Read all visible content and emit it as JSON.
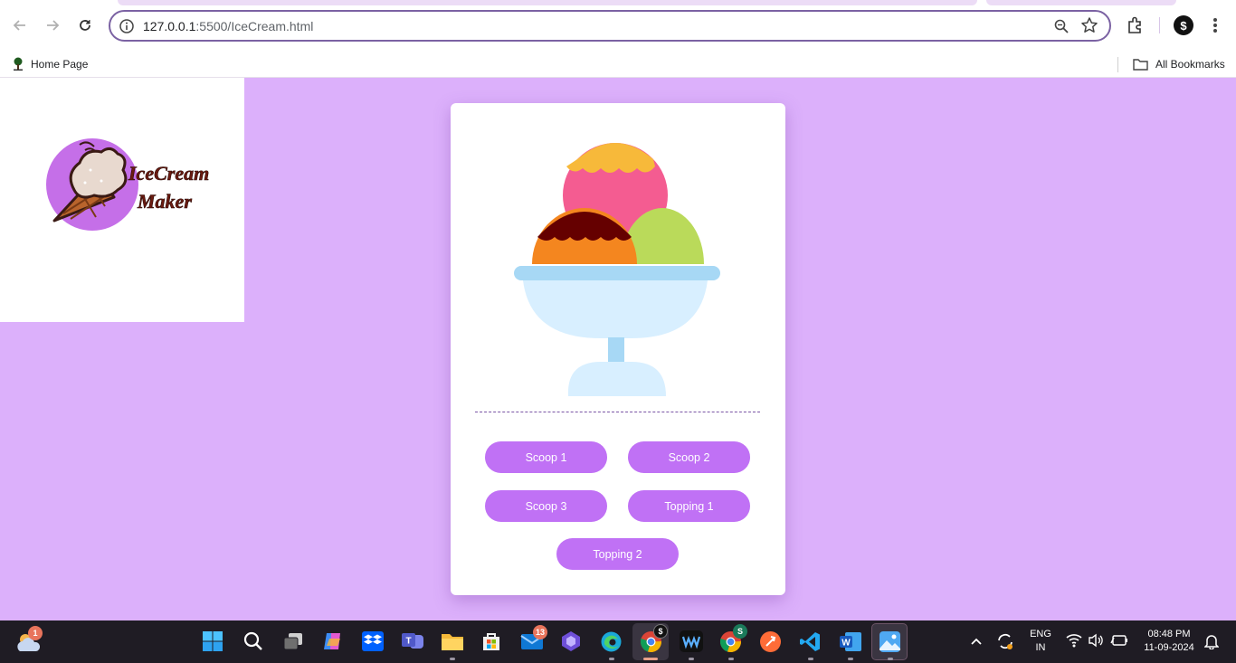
{
  "browser": {
    "url_host": "127.0.0.1",
    "url_path": ":5500/IceCream.html",
    "bookmarks": {
      "home_label": "Home Page",
      "all_label": "All Bookmarks"
    },
    "profile_glyph": "$"
  },
  "logo": {
    "line1": "IceCream",
    "line2": "Maker",
    "colors": {
      "circle": "#c56fe8",
      "text": "#5a1a10"
    }
  },
  "builder": {
    "buttons": [
      {
        "label": "Scoop 1"
      },
      {
        "label": "Scoop 2"
      },
      {
        "label": "Scoop 3"
      },
      {
        "label": "Topping 1"
      },
      {
        "label": "Topping 2"
      }
    ],
    "colors": {
      "background": "#dcb0fb",
      "button": "#c071f5",
      "scoop_top": "#f45c91",
      "topping_top": "#f7b93a",
      "scoop_left": "#f4861f",
      "topping_left": "#650000",
      "scoop_right": "#bada5a",
      "bowl": "#d8efff",
      "bowl_rim": "#a7d8f5"
    }
  },
  "taskbar": {
    "weather_badge": "1",
    "mail_badge": "13",
    "chrome_badge": "$",
    "chrome2_badge": "S",
    "lang_top": "ENG",
    "lang_bottom": "IN",
    "time": "08:48 PM",
    "date": "11-09-2024"
  }
}
